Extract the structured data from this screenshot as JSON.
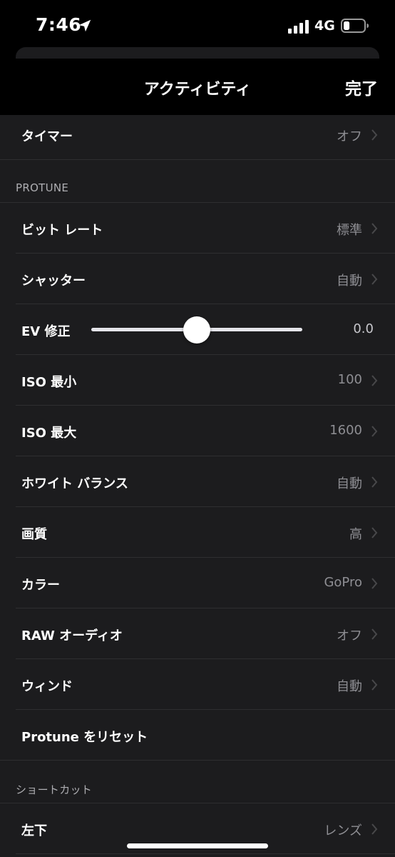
{
  "status_bar": {
    "time": "7:46",
    "network": "4G",
    "location_icon": "location-arrow-icon",
    "signal_icon": "cellular-signal-icon",
    "battery_icon": "battery-icon",
    "battery_level": 0.3
  },
  "nav": {
    "title": "アクティビティ",
    "done_label": "完了"
  },
  "rows_top": [
    {
      "label": "タイマー",
      "value": "オフ"
    }
  ],
  "sections": {
    "protune_header": "PROTUNE",
    "shortcut_header": "ショートカット"
  },
  "protune": {
    "bit_rate": {
      "label": "ビット レート",
      "value": "標準"
    },
    "shutter": {
      "label": "シャッター",
      "value": "自動"
    },
    "ev": {
      "label": "EV 修正",
      "value": "0.0",
      "slider_fraction": 0.5
    },
    "iso_min": {
      "label": "ISO 最小",
      "value": "100"
    },
    "iso_max": {
      "label": "ISO 最大",
      "value": "1600"
    },
    "white_balance": {
      "label": "ホワイト バランス",
      "value": "自動"
    },
    "quality": {
      "label": "画質",
      "value": "高"
    },
    "color": {
      "label": "カラー",
      "value": "GoPro"
    },
    "raw_audio": {
      "label": "RAW オーディオ",
      "value": "オフ"
    },
    "wind": {
      "label": "ウィンド",
      "value": "自動"
    },
    "reset": {
      "label": "Protune をリセット"
    }
  },
  "shortcut": {
    "bottom_left": {
      "label": "左下",
      "value": "レンズ"
    }
  },
  "colors": {
    "background": "#000000",
    "panel": "#1c1c1e",
    "secondary_text": "#8e8e93"
  }
}
